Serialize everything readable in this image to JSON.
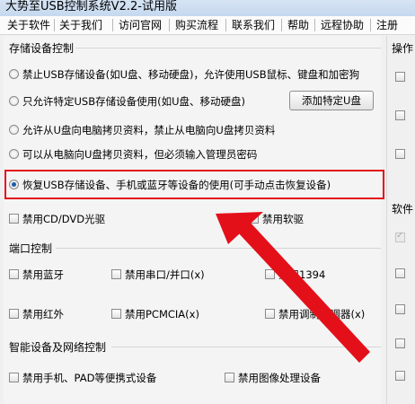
{
  "window": {
    "title": "大势至USB控制系统V2.2-试用版"
  },
  "menu": {
    "items": [
      "关于软件",
      "关于我们",
      "访问官网",
      "购买流程",
      "联系我们",
      "帮助",
      "远程协助",
      "注册"
    ]
  },
  "storage": {
    "title": "存储设备控制",
    "options": [
      "禁止USB存储设备(如U盘、移动硬盘)，允许使用USB鼠标、键盘和加密狗",
      "只允许特定USB存储设备使用(如U盘、移动硬盘)",
      "允许从U盘向电脑拷贝资料，禁止从电脑向U盘拷贝资料",
      "可以从电脑向U盘拷贝资料，但必须输入管理员密码",
      "恢复USB存储设备、手机或蓝牙等设备的使用(可手动点击恢复设备)"
    ],
    "selected_index": 4,
    "add_button_label": "添加特定U盘",
    "disable_cd": "禁用CD/DVD光驱",
    "disable_floppy": "禁用软驱"
  },
  "ports": {
    "title": "端口控制",
    "items": [
      "禁用蓝牙",
      "禁用串口/并口(x)",
      "禁用1394",
      "禁用红外",
      "禁用PCMCIA(x)",
      "禁用调制解调器(x)"
    ]
  },
  "smart": {
    "title": "智能设备及网络控制",
    "items": [
      "禁用手机、PAD等便携式设备",
      "禁用图像处理设备"
    ]
  },
  "right_panel": {
    "title_top": "操作",
    "title_mid": "软件"
  },
  "colors": {
    "highlight": "#e3101a",
    "arrow": "#e3101a"
  }
}
